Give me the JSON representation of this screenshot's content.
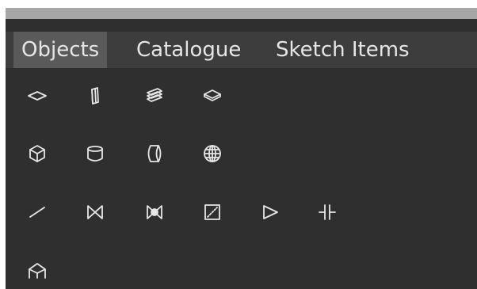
{
  "tabs": [
    {
      "label": "Objects",
      "active": true
    },
    {
      "label": "Catalogue",
      "active": false
    },
    {
      "label": "Sketch Items",
      "active": false
    }
  ],
  "icons": {
    "row1": [
      "plane-icon",
      "wall-icon",
      "stack-icon",
      "slab-icon"
    ],
    "row2": [
      "box-icon",
      "cylinder-icon",
      "capsule-icon",
      "sphere-icon"
    ],
    "row3": [
      "line-icon",
      "bowtie-icon",
      "valve-icon",
      "diagonal-square-icon",
      "triangle-icon",
      "capacitor-icon"
    ],
    "row4": [
      "roof-icon"
    ]
  },
  "colors": {
    "panel": "#2f2f2f",
    "tabbar": "#3d3d3d",
    "active_tab": "#5a5a5a",
    "text": "#e6e6e6"
  }
}
